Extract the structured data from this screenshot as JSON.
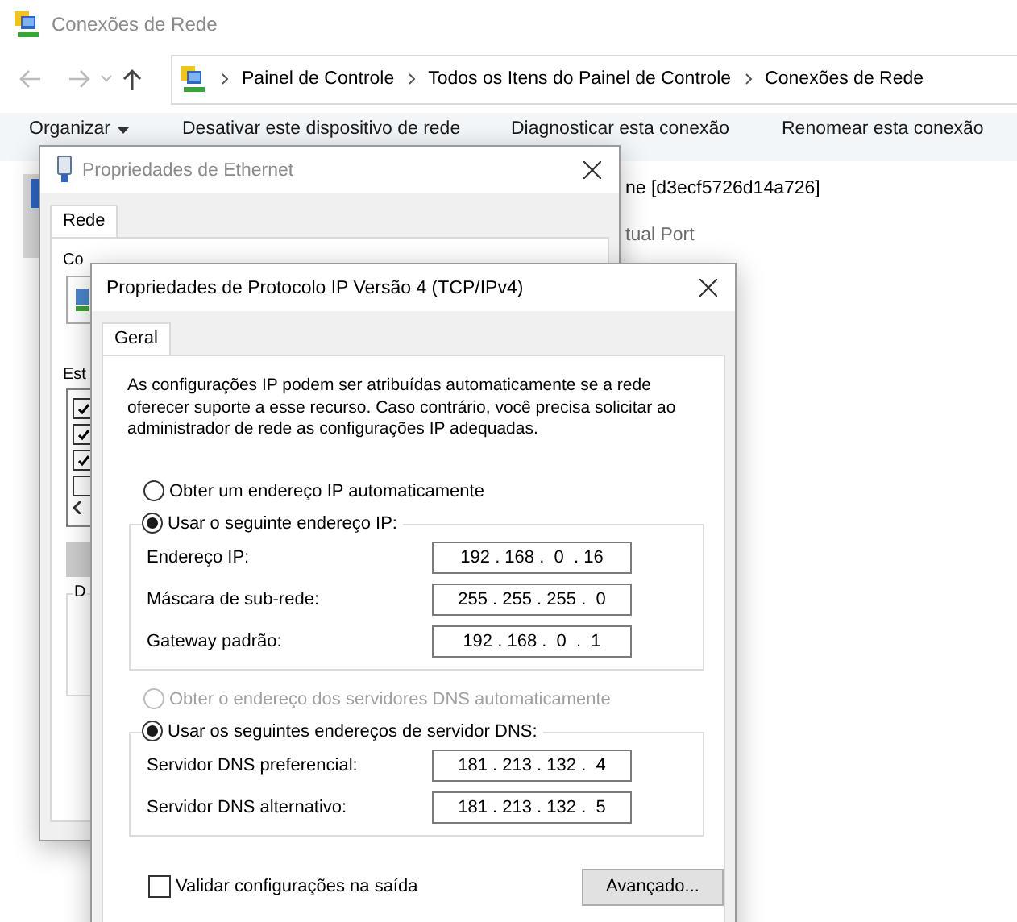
{
  "explorer": {
    "title": "Conexões de Rede",
    "breadcrumbs": [
      "Painel de Controle",
      "Todos os Itens do Painel de Controle",
      "Conexões de Rede"
    ],
    "toolbar": [
      "Organizar",
      "Desativar este dispositivo de rede",
      "Diagnosticar esta conexão",
      "Renomear esta conexão"
    ],
    "content_texts": [
      "ne [d3ecf5726d14a726]",
      "tual Port"
    ]
  },
  "ethernet_dialog": {
    "title": "Propriedades de Ethernet",
    "tabs": [
      {
        "label": "Rede",
        "selected": true
      }
    ],
    "labels": [
      "Co",
      "Est"
    ],
    "components": [
      {
        "checked": true
      },
      {
        "checked": true
      },
      {
        "checked": true
      },
      {
        "checked": false
      }
    ],
    "group_label": "D"
  },
  "ipv4_dialog": {
    "title": "Propriedades de Protocolo IP Versão 4 (TCP/IPv4)",
    "tabs": [
      {
        "label": "Geral",
        "selected": true
      }
    ],
    "description": "As configurações IP podem ser atribuídas automaticamente se a rede oferecer suporte a esse recurso. Caso contrário, você precisa solicitar ao administrador de rede as configurações IP adequadas.",
    "ip_mode": [
      {
        "label": "Obter um endereço IP automaticamente",
        "selected": false,
        "disabled": false
      },
      {
        "label": "Usar o seguinte endereço IP:",
        "selected": true,
        "disabled": false
      }
    ],
    "ip_fields": [
      {
        "label": "Endereço IP:",
        "value": "192 . 168 .  0  . 16"
      },
      {
        "label": "Máscara de sub-rede:",
        "value": "255 . 255 . 255 .  0"
      },
      {
        "label": "Gateway padrão:",
        "value": "192 . 168 .  0  .  1"
      }
    ],
    "dns_mode": [
      {
        "label": "Obter o endereço dos servidores DNS automaticamente",
        "selected": false,
        "disabled": true
      },
      {
        "label": "Usar os seguintes endereços de servidor DNS:",
        "selected": true,
        "disabled": false
      }
    ],
    "dns_fields": [
      {
        "label": "Servidor DNS preferencial:",
        "value": "181 . 213 . 132 .  4"
      },
      {
        "label": "Servidor DNS alternativo:",
        "value": "181 . 213 . 132 .  5"
      }
    ],
    "validate": {
      "label": "Validar configurações na saída",
      "checked": false
    },
    "advanced_button": "Avançado..."
  }
}
